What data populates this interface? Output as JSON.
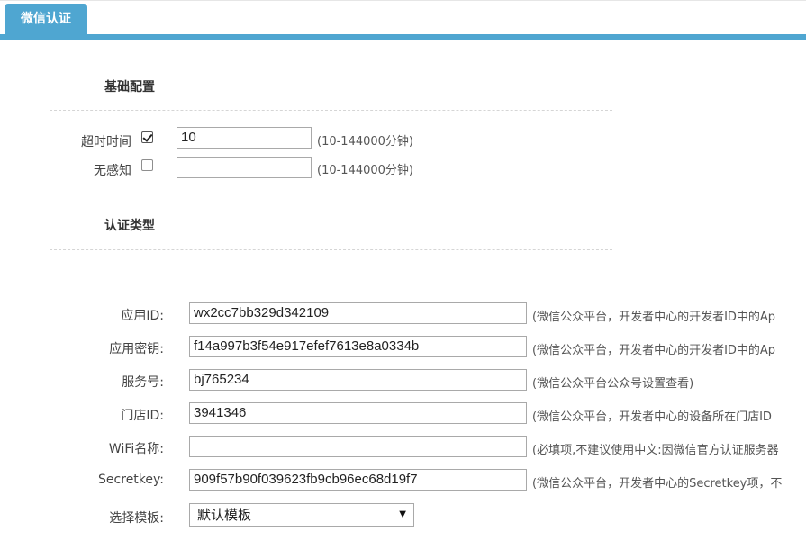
{
  "tab": {
    "label": "微信认证",
    "color": "#4fa6d1"
  },
  "basic": {
    "title": "基础配置",
    "timeout": {
      "label": "超时时间",
      "checked": true,
      "value": "10",
      "hint": "(10-144000分钟)"
    },
    "seamless": {
      "label": "无感知",
      "checked": false,
      "value": "",
      "hint": "(10-144000分钟)"
    }
  },
  "auth": {
    "title": "认证类型",
    "app_id": {
      "label": "应用ID:",
      "value": "wx2cc7bb329d342109",
      "hint": "(微信公众平台，开发者中心的开发者ID中的Ap"
    },
    "app_secret": {
      "label": "应用密钥:",
      "value": "f14a997b3f54e917efef7613e8a0334b",
      "hint": "(微信公众平台，开发者中心的开发者ID中的Ap"
    },
    "service_no": {
      "label": "服务号:",
      "value": "bj765234",
      "hint": "(微信公众平台公众号设置查看)"
    },
    "shop_id": {
      "label": "门店ID:",
      "value": "3941346",
      "hint": "(微信公众平台，开发者中心的设备所在门店ID"
    },
    "wifi_name": {
      "label": "WiFi名称:",
      "value": "",
      "hint": "(必填项,不建议使用中文:因微信官方认证服务器"
    },
    "secretkey": {
      "label": "Secretkey:",
      "value": "909f57b90f039623fb9cb96ec68d19f7",
      "hint": "(微信公众平台，开发者中心的Secretkey项，不"
    },
    "template": {
      "label": "选择模板:",
      "selected": "默认模板",
      "icon": "chevron-down-icon"
    }
  }
}
